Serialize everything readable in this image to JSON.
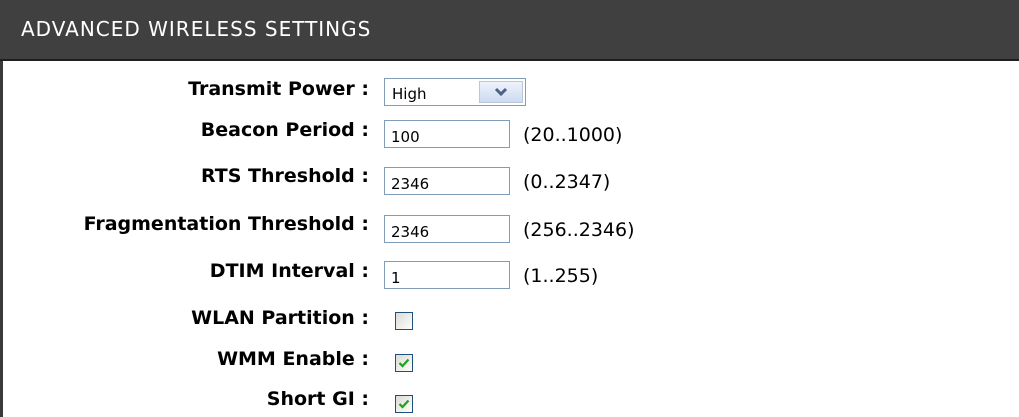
{
  "section": {
    "title": "ADVANCED WIRELESS SETTINGS"
  },
  "fields": {
    "transmit_power": {
      "label": "Transmit Power :",
      "value": "High"
    },
    "beacon_period": {
      "label": "Beacon Period :",
      "value": "100",
      "range": "(20..1000)"
    },
    "rts_threshold": {
      "label": "RTS Threshold :",
      "value": "2346",
      "range": "(0..2347)"
    },
    "fragmentation_threshold": {
      "label": "Fragmentation Threshold :",
      "value": "2346",
      "range": "(256..2346)"
    },
    "dtim_interval": {
      "label": "DTIM Interval :",
      "value": "1",
      "range": "(1..255)"
    },
    "wlan_partition": {
      "label": "WLAN Partition :",
      "checked": false
    },
    "wmm_enable": {
      "label": "WMM Enable :",
      "checked": true
    },
    "short_gi": {
      "label": "Short GI :",
      "checked": true
    }
  },
  "icons": {
    "dropdown": "chevron-down-icon",
    "check": "checkmark-icon"
  },
  "colors": {
    "header_background": "#404040",
    "header_text": "#ffffff",
    "input_border": "#7f9db9",
    "checkmark": "#21a121"
  }
}
